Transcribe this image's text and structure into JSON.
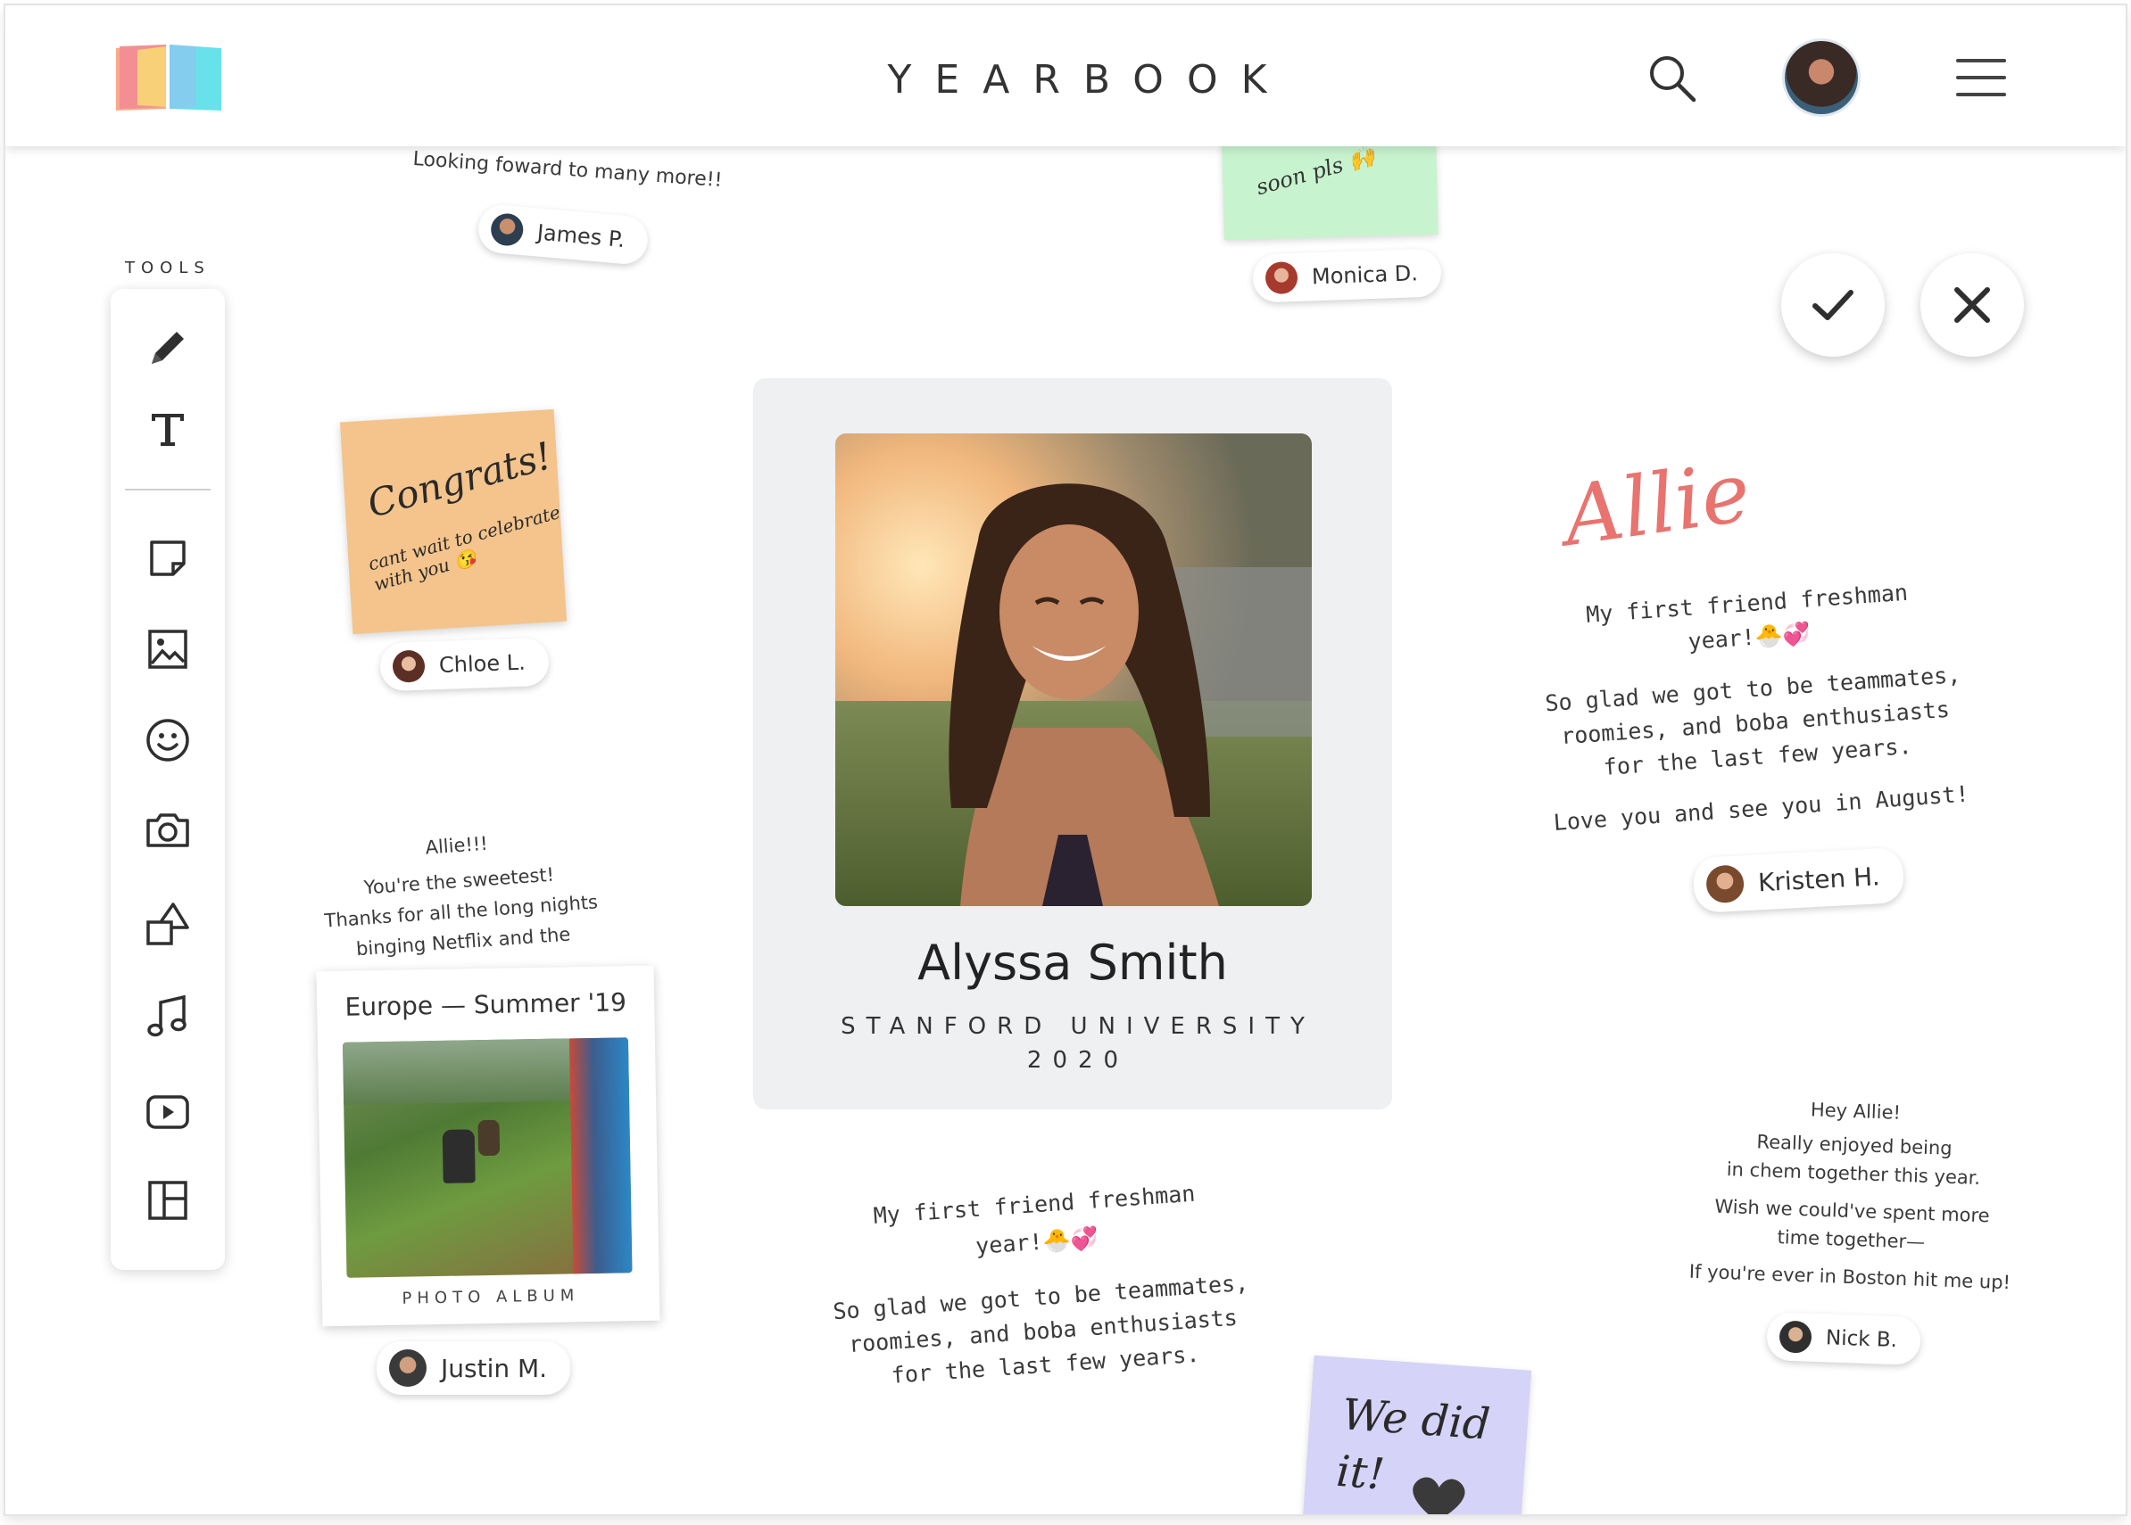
{
  "header": {
    "title": "YEARBOOK"
  },
  "tools": {
    "label": "TOOLS",
    "items": [
      "pencil-icon",
      "text-icon",
      "sticky-note-icon",
      "image-icon",
      "emoji-icon",
      "camera-icon",
      "shapes-icon",
      "music-icon",
      "video-icon",
      "layout-icon"
    ]
  },
  "profile": {
    "name": "Alyssa Smith",
    "school": "STANFORD UNIVERSITY",
    "year": "2020"
  },
  "notes": {
    "james": {
      "text": "Looking foward to many more!!",
      "author": "James P."
    },
    "monica": {
      "text": "soon pls 🙌",
      "author": "Monica D.",
      "color": "#c8f3cf"
    },
    "chloe": {
      "line1": "Congrats!",
      "line2": "cant wait to celebrate",
      "line3": "with you 😘",
      "author": "Chloe L.",
      "color": "#f4c48c"
    },
    "allie_left": {
      "line1": "Allie!!!",
      "line2": "You're the sweetest!",
      "line3": "Thanks for all the long nights",
      "line4": "binging Netflix and the"
    },
    "album": {
      "title": "Europe — Summer '19",
      "caption": "PHOTO ALBUM",
      "author": "Justin M."
    },
    "center_bottom": {
      "line1": "My first friend freshman",
      "line2": "year!🐣💞",
      "line3": "So glad we got to be teammates,",
      "line4": "roomies, and boba enthusiasts",
      "line5": "for the last few years."
    },
    "kristen": {
      "signature": "Allie",
      "line1": "My first friend freshman",
      "line2": "year!🐣💞",
      "line3": "So glad we got to be teammates,",
      "line4": "roomies, and boba enthusiasts",
      "line5": "for the last few years.",
      "line6": "Love you and see you in August!",
      "author": "Kristen H.",
      "signature_color": "#e8736f"
    },
    "nick": {
      "line1": "Hey Allie!",
      "line2": "Really enjoyed being",
      "line3": "in chem together this year.",
      "line4": "Wish we could've spent more",
      "line5": "time together—",
      "line6": "If you're ever in Boston hit me up!",
      "author": "Nick B."
    },
    "purple": {
      "line1": "We did",
      "line2": "it!",
      "color": "#d5d3f7"
    }
  },
  "actions": {
    "confirm_icon": "check-icon",
    "cancel_icon": "close-icon"
  }
}
